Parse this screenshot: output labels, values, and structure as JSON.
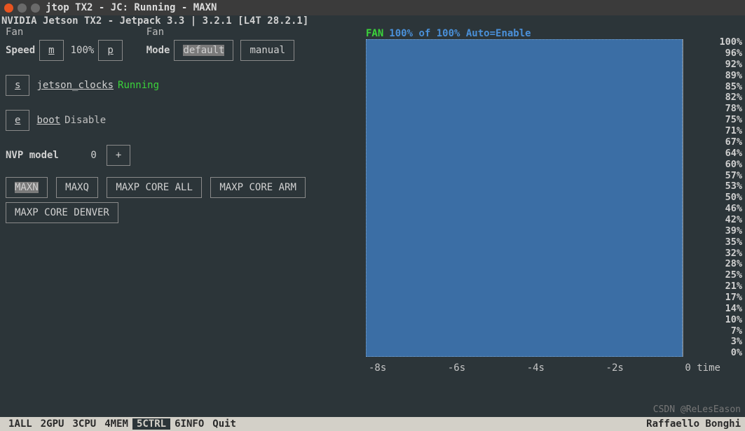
{
  "titlebar": {
    "title": "jtop TX2 - JC: Running - MAXN"
  },
  "header_line": "NVIDIA Jetson TX2 - Jetpack 3.3 | 3.2.1 [L4T 28.2.1]",
  "fan": {
    "speed_label": "Fan",
    "speed_label2": "Speed",
    "m_btn": "m",
    "speed_value": "100%",
    "p_btn": "p",
    "mode_label": "Fan",
    "mode_label2": "Mode",
    "default_btn": "default",
    "manual_btn": "manual"
  },
  "jetson_clocks": {
    "s_btn": "s",
    "label": "jetson_clocks",
    "status": "Running"
  },
  "boot": {
    "e_btn": "e",
    "label": "boot",
    "status": "Disable"
  },
  "nvp": {
    "label": "NVP model",
    "value": "0",
    "plus_btn": "+",
    "modes": [
      "MAXN",
      "MAXQ",
      "MAXP CORE ALL",
      "MAXP CORE ARM",
      "MAXP CORE DENVER"
    ]
  },
  "chart": {
    "fan_label": "FAN",
    "status": "100% of 100% Auto=Enable"
  },
  "chart_data": {
    "type": "area",
    "title": "FAN",
    "ylabel": "%",
    "xlabel": "time",
    "ylim": [
      0,
      100
    ],
    "series": [
      {
        "name": "FAN",
        "x": [
          -8,
          -6,
          -4,
          -2,
          0
        ],
        "values": [
          100,
          100,
          100,
          100,
          100
        ]
      }
    ],
    "x_ticks": [
      "-8s",
      "-6s",
      "-4s",
      "-2s",
      "0 time"
    ],
    "y_ticks": [
      "100%",
      "96%",
      "92%",
      "89%",
      "85%",
      "82%",
      "78%",
      "75%",
      "71%",
      "67%",
      "64%",
      "60%",
      "57%",
      "53%",
      "50%",
      "46%",
      "42%",
      "39%",
      "35%",
      "32%",
      "28%",
      "25%",
      "21%",
      "17%",
      "14%",
      "10%",
      "7%",
      "3%",
      "0%"
    ]
  },
  "tabs": [
    {
      "n": "1",
      "l": "ALL"
    },
    {
      "n": "2",
      "l": "GPU"
    },
    {
      "n": "3",
      "l": "CPU"
    },
    {
      "n": "4",
      "l": "MEM"
    },
    {
      "n": "5",
      "l": "CTRL"
    },
    {
      "n": "6",
      "l": "INFO"
    },
    {
      "n": "Q",
      "l": "uit"
    }
  ],
  "credit": "Raffaello Bonghi",
  "watermark": "CSDN @ReLesEason"
}
